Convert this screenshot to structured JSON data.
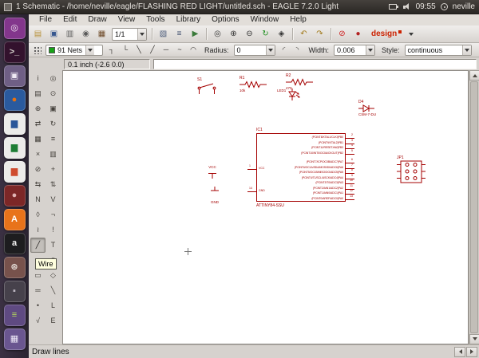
{
  "colors": {
    "schematic_red": "#a40000",
    "net_layer_green": "#17a317",
    "canvas_bg": "#ffffff",
    "panel_bg": "#2f2b28"
  },
  "panel": {
    "title": "1 Schematic - /home/neville/eagle/FLASHING RED LIGHT/untitled.sch - EAGLE 7.2.0 Light",
    "clock": "09:55",
    "user": "neville"
  },
  "menubar": {
    "items": [
      {
        "id": "menu-file",
        "label": "File"
      },
      {
        "id": "menu-edit",
        "label": "Edit"
      },
      {
        "id": "menu-draw",
        "label": "Draw"
      },
      {
        "id": "menu-view",
        "label": "View"
      },
      {
        "id": "menu-tools",
        "label": "Tools"
      },
      {
        "id": "menu-library",
        "label": "Library"
      },
      {
        "id": "menu-options",
        "label": "Options"
      },
      {
        "id": "menu-window",
        "label": "Window"
      },
      {
        "id": "menu-help",
        "label": "Help"
      }
    ]
  },
  "toolbar_main": {
    "sheet": "1/1",
    "design": "design",
    "group_file": [
      {
        "id": "open-icon",
        "glyph": "▤",
        "fg": "#b8923a"
      },
      {
        "id": "save-icon",
        "glyph": "▣",
        "fg": "#37578f"
      },
      {
        "id": "print-icon",
        "glyph": "▥",
        "fg": "#5a5a5a"
      },
      {
        "id": "cam-processor-icon",
        "glyph": "◉",
        "fg": "#5a5a5a"
      },
      {
        "id": "switch-to-board-icon",
        "glyph": "▦",
        "fg": "#6e4a28"
      }
    ],
    "group_cmd": [
      {
        "id": "use-library-icon",
        "glyph": "▧",
        "fg": "#4a5a7a"
      },
      {
        "id": "script-icon",
        "glyph": "≡",
        "fg": "#3a4a6a"
      },
      {
        "id": "run-ulp-icon",
        "glyph": "▶",
        "fg": "#3a7a3a"
      }
    ],
    "group_zoom": [
      {
        "id": "zoom-fit-icon",
        "glyph": "◎",
        "fg": "#333333"
      },
      {
        "id": "zoom-in-icon",
        "glyph": "⊕",
        "fg": "#333333"
      },
      {
        "id": "zoom-out-icon",
        "glyph": "⊖",
        "fg": "#333333"
      },
      {
        "id": "redraw-icon",
        "glyph": "↻",
        "fg": "#1f8f1f"
      },
      {
        "id": "zoom-select-icon",
        "glyph": "◈",
        "fg": "#333333"
      }
    ],
    "group_undo": [
      {
        "id": "undo-icon",
        "glyph": "↶",
        "fg": "#a07818"
      },
      {
        "id": "redo-icon",
        "glyph": "↷",
        "fg": "#a07818"
      }
    ],
    "group_stop": [
      {
        "id": "stop-icon",
        "glyph": "⊘",
        "fg": "#cc1a1a"
      },
      {
        "id": "go-icon",
        "glyph": "●",
        "fg": "#b22222"
      }
    ]
  },
  "toolbar_params": {
    "layer": "91 Nets",
    "radius_label": "Radius:",
    "radius": "0",
    "width_label": "Width:",
    "width": "0.006",
    "style_label": "Style:",
    "style": "continuous",
    "bends": [
      {
        "id": "bend-90-down-icon",
        "glyph": "┐"
      },
      {
        "id": "bend-90-up-icon",
        "glyph": "└"
      },
      {
        "id": "bend-45-down-icon",
        "glyph": "╲"
      },
      {
        "id": "bend-45-up-icon",
        "glyph": "╱"
      },
      {
        "id": "bend-straight-icon",
        "glyph": "─"
      },
      {
        "id": "bend-freehand-icon",
        "glyph": "~"
      },
      {
        "id": "bend-arc-icon",
        "glyph": "◠"
      }
    ],
    "arcs": [
      {
        "id": "arc-ccw-icon",
        "glyph": "◜"
      },
      {
        "id": "arc-cw-icon",
        "glyph": "◝"
      }
    ]
  },
  "coordbar": {
    "position": "0.1 inch (-2.6 0.0)",
    "command": ""
  },
  "statusbar": {
    "text": "Draw lines"
  },
  "tooltip": {
    "text": "Wire"
  },
  "launcher": {
    "items": [
      {
        "id": "launcher-dash-home",
        "bg": "#83368c",
        "glyph": "◎",
        "fg": "#f2e6f2"
      },
      {
        "id": "launcher-terminal",
        "bg": "#33122d",
        "glyph": ">_",
        "fg": "#d8d4ce"
      },
      {
        "id": "launcher-files",
        "bg": "#6f5f85",
        "glyph": "▣",
        "fg": "#efeaf4"
      },
      {
        "id": "launcher-firefox",
        "bg": "#2a5a9e",
        "glyph": "●",
        "fg": "#e8720e"
      },
      {
        "id": "launcher-libreoffice-writer",
        "bg": "#ecebe9",
        "glyph": "▆",
        "fg": "#2a5699"
      },
      {
        "id": "launcher-libreoffice-calc",
        "bg": "#ecebe9",
        "glyph": "▆",
        "fg": "#1e7d34"
      },
      {
        "id": "launcher-libreoffice-impress",
        "bg": "#ecebe9",
        "glyph": "▆",
        "fg": "#cf4b2e"
      },
      {
        "id": "launcher-media-player",
        "bg": "#7c2727",
        "glyph": "●",
        "fg": "#e0b4b4"
      },
      {
        "id": "launcher-software-center",
        "bg": "#e8731a",
        "glyph": "A",
        "fg": "#ffffff"
      },
      {
        "id": "launcher-amazon",
        "bg": "#1d1d1f",
        "glyph": "a",
        "fg": "#f5f5f5"
      },
      {
        "id": "launcher-system-settings",
        "bg": "#77524c",
        "glyph": "⊛",
        "fg": "#e8e2dc"
      },
      {
        "id": "launcher-gimp",
        "bg": "#46414b",
        "glyph": "▪",
        "fg": "#bdb7c2"
      },
      {
        "id": "launcher-text-editor",
        "bg": "#5f4a82",
        "glyph": "≡",
        "fg": "#b8e05a"
      },
      {
        "id": "launcher-workspaces",
        "bg": "#6a5690",
        "glyph": "▦",
        "fg": "#efeaf8"
      }
    ]
  },
  "palette": {
    "tools": [
      {
        "id": "tool-info",
        "glyph": "i"
      },
      {
        "id": "tool-show",
        "glyph": "◎"
      },
      {
        "id": "tool-display",
        "glyph": "▤"
      },
      {
        "id": "tool-mark",
        "glyph": "⊙"
      },
      {
        "id": "tool-move",
        "glyph": "⊕"
      },
      {
        "id": "tool-copy",
        "glyph": "▣"
      },
      {
        "id": "tool-mirror",
        "glyph": "⇄"
      },
      {
        "id": "tool-rotate",
        "glyph": "↻"
      },
      {
        "id": "tool-group",
        "glyph": "▦"
      },
      {
        "id": "tool-change",
        "glyph": "≡"
      },
      {
        "id": "tool-cut",
        "glyph": "×"
      },
      {
        "id": "tool-paste",
        "glyph": "▥"
      },
      {
        "id": "tool-delete",
        "glyph": "⊘"
      },
      {
        "id": "tool-add",
        "glyph": "+"
      },
      {
        "id": "tool-pinswap",
        "glyph": "⇆"
      },
      {
        "id": "tool-replace",
        "glyph": "⇅"
      },
      {
        "id": "tool-name",
        "glyph": "N"
      },
      {
        "id": "tool-value",
        "glyph": "V"
      },
      {
        "id": "tool-smash",
        "glyph": "◊"
      },
      {
        "id": "tool-miter",
        "glyph": "¬"
      },
      {
        "id": "tool-split",
        "glyph": "≀"
      },
      {
        "id": "tool-invoke",
        "glyph": "!"
      },
      {
        "id": "tool-wire",
        "glyph": "╱",
        "active": true
      },
      {
        "id": "tool-text",
        "glyph": "T"
      },
      {
        "id": "tool-circle",
        "glyph": "○"
      },
      {
        "id": "tool-arc",
        "glyph": "◠"
      },
      {
        "id": "tool-rect",
        "glyph": "▭"
      },
      {
        "id": "tool-polygon",
        "glyph": "◇"
      },
      {
        "id": "tool-bus",
        "glyph": "═"
      },
      {
        "id": "tool-net",
        "glyph": "╲"
      },
      {
        "id": "tool-junction",
        "glyph": "•"
      },
      {
        "id": "tool-label",
        "glyph": "L"
      },
      {
        "id": "tool-erc",
        "glyph": "√"
      },
      {
        "id": "tool-errors",
        "glyph": "E"
      }
    ]
  },
  "schematic": {
    "s1": {
      "name": "S1"
    },
    "r1": {
      "name": "R1",
      "value": "10k"
    },
    "r2": {
      "name": "R2",
      "value": "470"
    },
    "led1": {
      "name": "LED1"
    },
    "d4": {
      "name": "D4",
      "value": "CSM-7-DU"
    },
    "vcc": {
      "label": "VCC"
    },
    "gnd": {
      "label": "GND"
    },
    "jp1": {
      "name": "JP1"
    },
    "ic1": {
      "name": "IC1",
      "value": "ATTINY84-SSU",
      "left_pins": [
        {
          "num": "1",
          "label": "VCC"
        },
        {
          "num": "14",
          "label": "GND"
        }
      ],
      "right_pins_top": [
        {
          "num": "2",
          "label": "(PCINT8/XTAL1/CLKI)PB0"
        },
        {
          "num": "3",
          "label": "(PCINT9/XTAL2)PB1"
        },
        {
          "num": "4",
          "label": "(PCINT11/RESET/dW)PB3"
        },
        {
          "num": "5",
          "label": "(PCINT10/INT0/OC0A/CKOUT)PB2"
        }
      ],
      "right_pins_bottom": [
        {
          "num": "6",
          "label": "(PCINT7/ICP/OC0B/ADC7)PA7"
        },
        {
          "num": "7",
          "label": "(PCINT6/OC1A/SDA/MOSI/DI/ADC6)PA6"
        },
        {
          "num": "8",
          "label": "(PCINT5/OC1B/MISO/DO/ADC5)PA5"
        },
        {
          "num": "9",
          "label": "(PCINT4/T1/SCL/USCK/ADC4)PA4"
        },
        {
          "num": "10",
          "label": "(PCINT3/T0/ADC3)PA3"
        },
        {
          "num": "11",
          "label": "(PCINT2/AIN1/ADC2)PA2"
        },
        {
          "num": "12",
          "label": "(PCINT1/AIN0/ADC1)PA1"
        },
        {
          "num": "13",
          "label": "(PCINT0/AREF/ADC0)PA0"
        }
      ]
    }
  }
}
